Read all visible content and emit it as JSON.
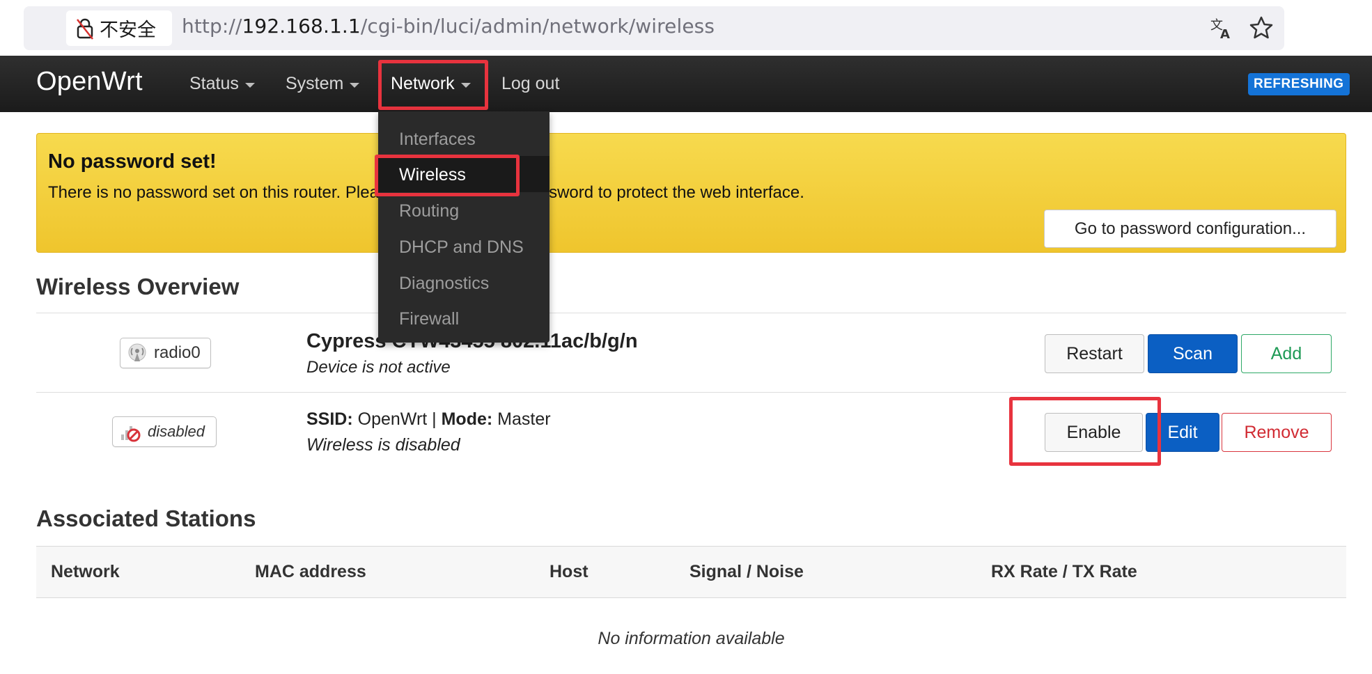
{
  "browser": {
    "security_label": "不安全",
    "url_scheme": "http://",
    "url_host": "192.168.1.1",
    "url_path": "/cgi-bin/luci/admin/network/wireless"
  },
  "header": {
    "brand": "OpenWrt",
    "nav": {
      "status": "Status",
      "system": "System",
      "network": "Network",
      "logout": "Log out"
    },
    "refresh_badge": "REFRESHING"
  },
  "network_menu": {
    "items": [
      "Interfaces",
      "Wireless",
      "Routing",
      "DHCP and DNS",
      "Diagnostics",
      "Firewall"
    ],
    "active": "Wireless"
  },
  "alert": {
    "title": "No password set!",
    "text": "There is no password set on this router. Please configure a root password to protect the web interface.",
    "button": "Go to password configuration..."
  },
  "wireless_overview": {
    "heading": "Wireless Overview",
    "radio": {
      "badge": "radio0",
      "title": "Cypress CYW43455 802.11ac/b/g/n",
      "status": "Device is not active",
      "buttons": {
        "restart": "Restart",
        "scan": "Scan",
        "add": "Add"
      }
    },
    "network": {
      "badge": "disabled",
      "ssid_label": "SSID:",
      "ssid": "OpenWrt",
      "mode_label": "Mode:",
      "mode": "Master",
      "status": "Wireless is disabled",
      "buttons": {
        "enable": "Enable",
        "edit": "Edit",
        "remove": "Remove"
      }
    }
  },
  "stations": {
    "heading": "Associated Stations",
    "columns": [
      "Network",
      "MAC address",
      "Host",
      "Signal / Noise",
      "RX Rate / TX Rate"
    ],
    "empty": "No information available"
  },
  "colors": {
    "accent_blue": "#0b5fc3",
    "highlight_red": "#e8333e",
    "warning_yellow": "#f3cc36"
  }
}
